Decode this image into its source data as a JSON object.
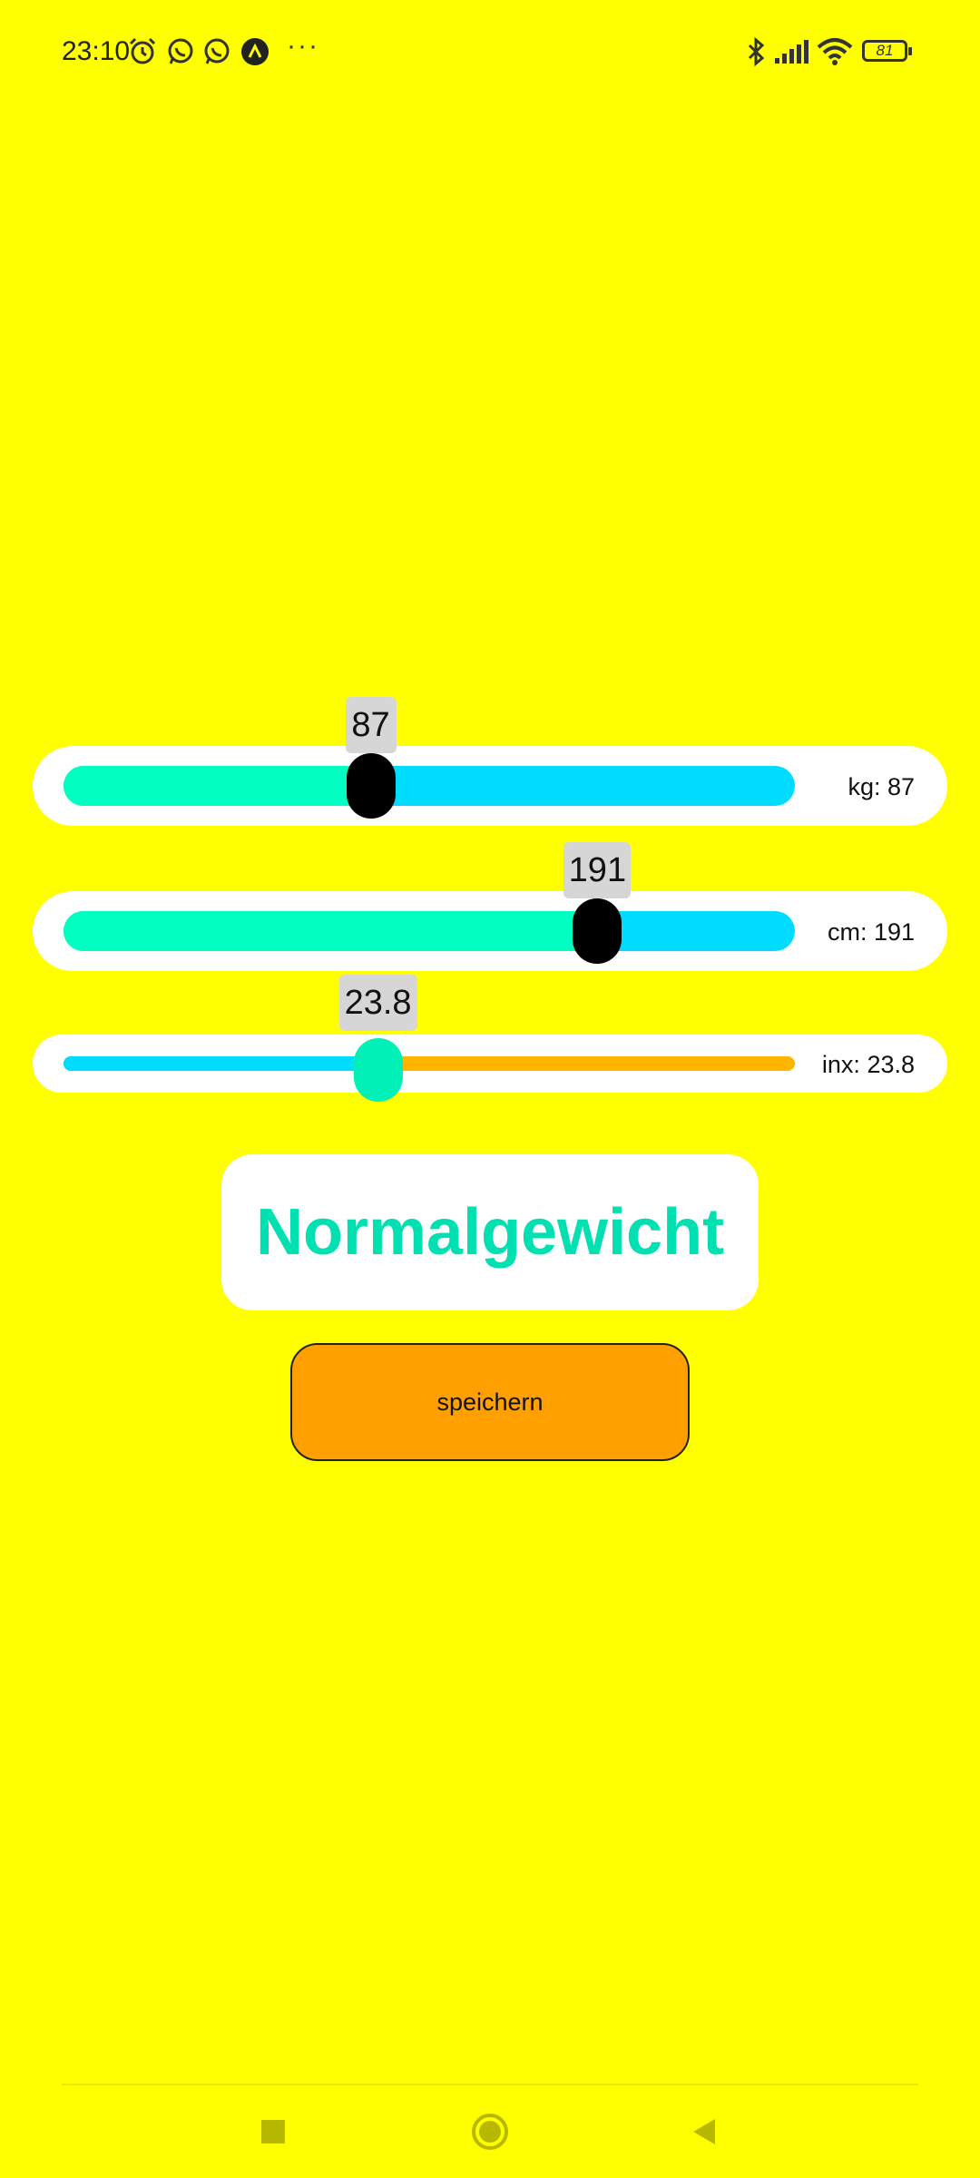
{
  "status_bar": {
    "time": "23:10",
    "battery": "81",
    "icons": [
      "alarm-icon",
      "whatsapp-icon",
      "whatsapp-icon",
      "app-icon",
      "more-dots-icon",
      "bluetooth-icon",
      "signal-icon",
      "wifi-icon",
      "battery-icon"
    ],
    "more": "···"
  },
  "sliders": {
    "weight": {
      "bubble": "87",
      "label": "kg: 87",
      "value": 87,
      "position": 0.42
    },
    "height": {
      "bubble": "191",
      "label": "cm: 191",
      "value": 191,
      "position": 0.73
    },
    "index": {
      "bubble": "23.8",
      "label": "inx: 23.8",
      "value": 23.8,
      "position": 0.43
    }
  },
  "result": {
    "text": "Normalgewicht"
  },
  "save_button": {
    "label": "speichern"
  },
  "nav": [
    "recents-square-icon",
    "home-circle-icon",
    "back-triangle-icon"
  ],
  "colors": {
    "background": "#FFFF00",
    "fill": "#00FFC0",
    "track": "#00DCFF",
    "thumb": "#000000",
    "index_thumb": "#00F0B8",
    "index_right": "#FFB400",
    "result_text": "#00E0B0",
    "button": "#FFA000"
  }
}
